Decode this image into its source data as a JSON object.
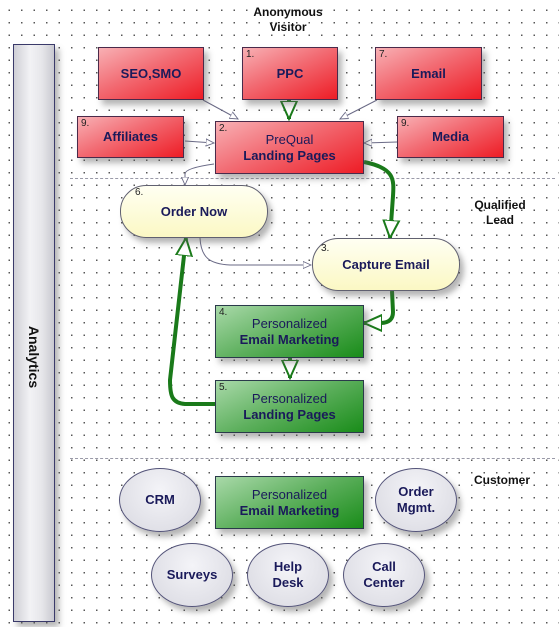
{
  "swimlanes": [
    {
      "id": "anonymous",
      "label": "Anonymous\nVisitor"
    },
    {
      "id": "qualified",
      "label": "Qualified\nLead"
    },
    {
      "id": "customer",
      "label": "Customer"
    }
  ],
  "labels": {
    "anonymous_line1": "Anonymous",
    "anonymous_line2": "Visitor",
    "qualified_line1": "Qualified",
    "qualified_line2": "Lead",
    "customer": "Customer"
  },
  "analytics": {
    "label": "Analytics"
  },
  "nodes": {
    "seo": {
      "number": "",
      "line1": "",
      "line2": "SEO,SMO",
      "color": "#ee1c25"
    },
    "ppc": {
      "number": "1.",
      "line1": "",
      "line2": "PPC",
      "color": "#ee1c25"
    },
    "email": {
      "number": "7.",
      "line1": "",
      "line2": "Email",
      "color": "#ee1c25"
    },
    "affiliates": {
      "number": "9.",
      "line1": "",
      "line2": "Affiliates",
      "color": "#ee1c25"
    },
    "prequal": {
      "number": "2.",
      "line1": "PreQual",
      "line2": "Landing Pages",
      "color": "#ee1c25"
    },
    "media": {
      "number": "9.",
      "line1": "",
      "line2": "Media",
      "color": "#ee1c25"
    },
    "order_now": {
      "number": "6.",
      "line1": "",
      "line2": "Order Now",
      "color": "#fbf8c4"
    },
    "capture_email": {
      "number": "3.",
      "line1": "",
      "line2": "Capture Email",
      "color": "#fbf8c4"
    },
    "pers_email": {
      "number": "4.",
      "line1": "Personalized",
      "line2": "Email Marketing",
      "color": "#198c19"
    },
    "pers_landing": {
      "number": "5.",
      "line1": "Personalized",
      "line2": "Landing Pages",
      "color": "#198c19"
    },
    "cust_email": {
      "number": "",
      "line1": "Personalized",
      "line2": "Email Marketing",
      "color": "#198c19"
    },
    "crm": {
      "line1": "CRM",
      "line2": ""
    },
    "order_mgmt": {
      "line1": "Order",
      "line2": "Mgmt."
    },
    "surveys": {
      "line1": "Surveys",
      "line2": ""
    },
    "help_desk": {
      "line1": "Help",
      "line2": "Desk"
    },
    "call_center": {
      "line1": "Call",
      "line2": "Center"
    }
  },
  "connectors": [
    {
      "from": "seo",
      "to": "prequal",
      "style": "thin"
    },
    {
      "from": "ppc",
      "to": "prequal",
      "style": "green"
    },
    {
      "from": "email",
      "to": "prequal",
      "style": "thin"
    },
    {
      "from": "affiliates",
      "to": "prequal",
      "style": "thin"
    },
    {
      "from": "media",
      "to": "prequal",
      "style": "thin"
    },
    {
      "from": "prequal",
      "to": "order_now",
      "style": "thin"
    },
    {
      "from": "prequal",
      "to": "capture_email",
      "style": "green"
    },
    {
      "from": "order_now",
      "to": "capture_email",
      "style": "thin"
    },
    {
      "from": "capture_email",
      "to": "pers_email",
      "style": "green"
    },
    {
      "from": "pers_email",
      "to": "pers_landing",
      "style": "green"
    },
    {
      "from": "pers_landing",
      "to": "order_now",
      "style": "green"
    }
  ],
  "colors": {
    "thin_line": "#6a6a86",
    "green_line": "#1a7a1a",
    "text": "#1a1a5a"
  }
}
